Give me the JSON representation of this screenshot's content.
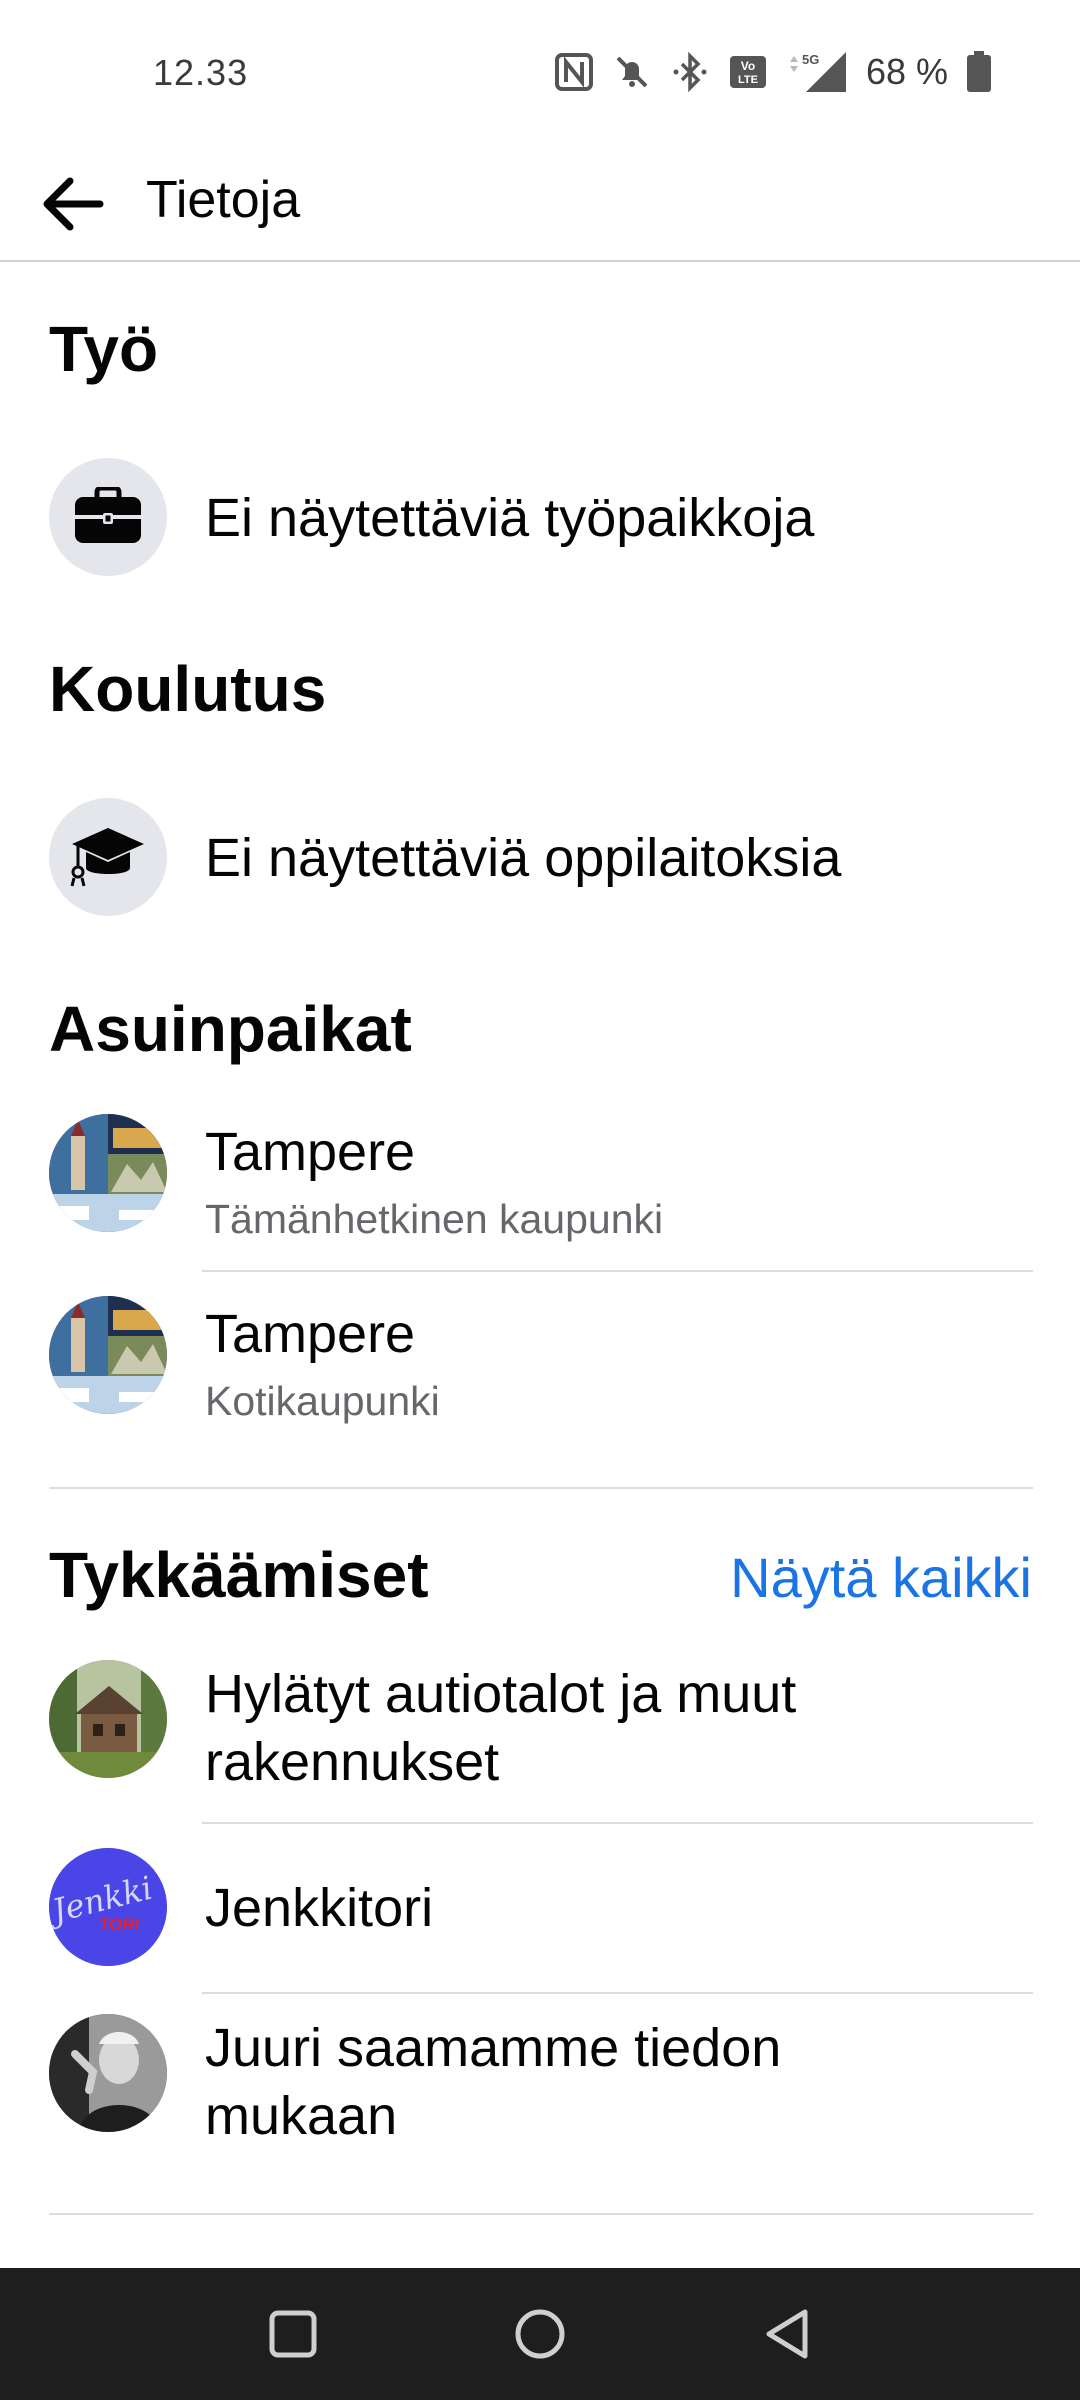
{
  "status_bar": {
    "time": "12.33",
    "battery": "68 %",
    "network": "5G"
  },
  "app_bar": {
    "title": "Tietoja"
  },
  "work": {
    "title": "Työ",
    "empty_text": "Ei näytettäviä työpaikkoja"
  },
  "education": {
    "title": "Koulutus",
    "empty_text": "Ei näytettäviä oppilaitoksia"
  },
  "places": {
    "title": "Asuinpaikat",
    "items": [
      {
        "name": "Tampere",
        "subtitle": "Tämänhetkinen kaupunki"
      },
      {
        "name": "Tampere",
        "subtitle": "Kotikaupunki"
      }
    ]
  },
  "likes": {
    "title": "Tykkäämiset",
    "see_all": "Näytä kaikki",
    "items": [
      {
        "line1": "Hylätyt autiotalot ja muut",
        "line2": "rakennukset"
      },
      {
        "line1": "Jenkkitori",
        "line2": ""
      },
      {
        "line1": "Juuri saamamme tiedon",
        "line2": "mukaan"
      }
    ],
    "jenkki_logo": {
      "script": "Jenkki",
      "tag": "TORI"
    }
  },
  "colors": {
    "accent": "#1b74e4",
    "secondary_text": "#65676b",
    "icon_bg": "#e4e6eb",
    "nav_bg": "#1e1e1e"
  }
}
